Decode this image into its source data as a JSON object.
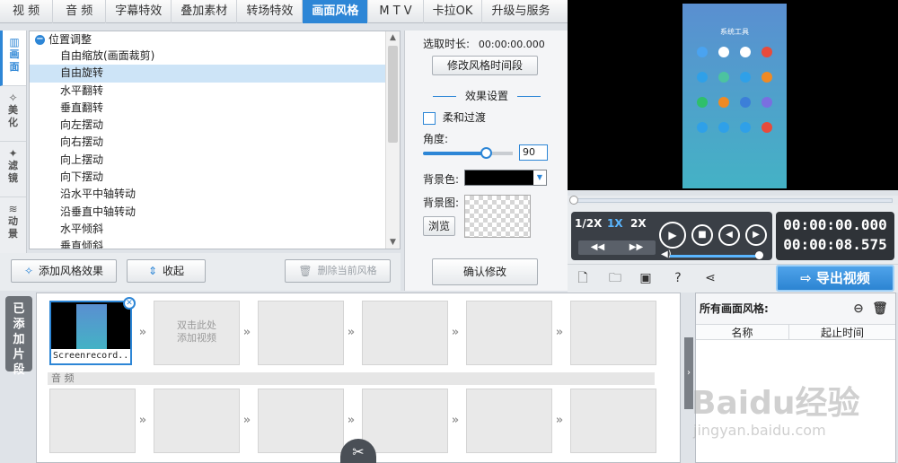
{
  "top_tabs": [
    "视 频",
    "音 频",
    "字幕特效",
    "叠加素材",
    "转场特效",
    "画面风格",
    "M T V",
    "卡拉OK",
    "升级与服务"
  ],
  "active_tab_index": 5,
  "side_tabs": [
    {
      "label": "画面",
      "icon": "picture-icon"
    },
    {
      "label": "美化",
      "icon": "magic-wand-icon"
    },
    {
      "label": "滤镜",
      "icon": "sparkle-wand-icon"
    },
    {
      "label": "动景",
      "icon": "wave-icon"
    }
  ],
  "effect_list": {
    "group_label": "位置调整",
    "items": [
      "自由缩放(画面裁剪)",
      "自由旋转",
      "水平翻转",
      "垂直翻转",
      "向左摆动",
      "向右摆动",
      "向上摆动",
      "向下摆动",
      "沿水平中轴转动",
      "沿垂直中轴转动",
      "水平倾斜",
      "垂直倾斜"
    ],
    "selected_index": 1
  },
  "buttons": {
    "add_effect": "添加风格效果",
    "collapse": "收起",
    "delete_effect": "删除当前风格"
  },
  "settings": {
    "duration_label": "选取时长:",
    "duration_value": "00:00:00.000",
    "modify_segment": "修改风格时间段",
    "effect_settings": "效果设置",
    "soft_transition": "柔和过渡",
    "angle_label": "角度:",
    "angle_value": "90",
    "angle_fraction": 0.7,
    "bg_color_label": "背景色:",
    "bg_color": "#000000",
    "bg_image_label": "背景图:",
    "browse": "浏览",
    "confirm": "确认修改"
  },
  "preview": {
    "phone_title": "系统工具",
    "app_colors": [
      "#4aa3f0",
      "#ffffff",
      "#ffffff",
      "#e84b3c",
      "#2fa0e8",
      "#4cc3a0",
      "#2fa0e8",
      "#f08a24",
      "#2fbf6b",
      "#f08a24",
      "#3c7fd8",
      "#7a6fe0",
      "#2fa0e8",
      "#2fa0e8",
      "#2fa0e8",
      "#e84b3c"
    ]
  },
  "player": {
    "speeds": [
      "1/2X",
      "1X",
      "2X"
    ],
    "active_speed": 1,
    "current_time": "00:00:00.000",
    "total_time": "00:00:08.575",
    "volume_fraction": 0.95
  },
  "toolbar_icons": [
    "new-project-icon",
    "open-folder-icon",
    "save-icon",
    "help-icon",
    "share-icon"
  ],
  "export_label": "导出视频",
  "timeline": {
    "label": "已添加片段",
    "clip_name": "Screenrecord...",
    "add_hint_line1": "双击此处",
    "add_hint_line2": "添加视频",
    "audio_label": "音 频"
  },
  "right_panel": {
    "title": "所有画面风格:",
    "col_name": "名称",
    "col_start": "起止时间"
  },
  "watermark": "Baidu经验",
  "watermark_url": "jingyan.baidu.com"
}
